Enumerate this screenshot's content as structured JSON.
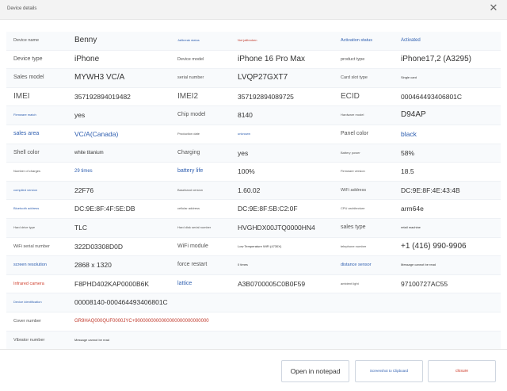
{
  "window": {
    "title": "Device details"
  },
  "rows": [
    {
      "c": [
        {
          "t": "Device name",
          "cls": "lbl small"
        },
        {
          "t": "Benny",
          "cls": "val big"
        },
        {
          "t": "Jailbreak status",
          "cls": "lbl tiny blue"
        },
        {
          "t": "Not jailbroken",
          "cls": "val tiny red"
        },
        {
          "t": "Activation status",
          "cls": "lbl small blue"
        },
        {
          "t": "Activated",
          "cls": "val small blue"
        }
      ]
    },
    {
      "c": [
        {
          "t": "Device type",
          "cls": "lbl"
        },
        {
          "t": "iPhone",
          "cls": "val big"
        },
        {
          "t": "Device model",
          "cls": "lbl small"
        },
        {
          "t": "iPhone 16 Pro Max",
          "cls": "val big"
        },
        {
          "t": "product type",
          "cls": "lbl small"
        },
        {
          "t": "iPhone17,2 (A3295)",
          "cls": "val big"
        }
      ]
    },
    {
      "c": [
        {
          "t": "Sales model",
          "cls": "lbl"
        },
        {
          "t": "MYWH3 VC/A",
          "cls": "val big"
        },
        {
          "t": "serial number",
          "cls": "lbl small"
        },
        {
          "t": "LVQP27GXT7",
          "cls": "val big"
        },
        {
          "t": "Card slot type",
          "cls": "lbl small"
        },
        {
          "t": "Single card",
          "cls": "val tiny"
        }
      ]
    },
    {
      "c": [
        {
          "t": "IMEI",
          "cls": "lbl big"
        },
        {
          "t": "357192894019482",
          "cls": "val"
        },
        {
          "t": "IMEI2",
          "cls": "lbl big"
        },
        {
          "t": "357192894089725",
          "cls": "val"
        },
        {
          "t": "ECID",
          "cls": "lbl big"
        },
        {
          "t": "0004644934068​01C",
          "cls": "val"
        }
      ]
    },
    {
      "c": [
        {
          "t": "Firmware match",
          "cls": "lbl tiny blue"
        },
        {
          "t": "yes",
          "cls": "val"
        },
        {
          "t": "Chip model",
          "cls": "lbl"
        },
        {
          "t": "8140",
          "cls": "val"
        },
        {
          "t": "Hardware model",
          "cls": "lbl tiny"
        },
        {
          "t": "D94AP",
          "cls": "val big"
        }
      ]
    },
    {
      "c": [
        {
          "t": "sales area",
          "cls": "lbl blue"
        },
        {
          "t": "VC/A(Canada)",
          "cls": "val blue"
        },
        {
          "t": "Production date",
          "cls": "lbl tiny"
        },
        {
          "t": "unknown",
          "cls": "val tiny blue"
        },
        {
          "t": "Panel color",
          "cls": "lbl"
        },
        {
          "t": "black",
          "cls": "val blue"
        }
      ]
    },
    {
      "c": [
        {
          "t": "Shell color",
          "cls": "lbl"
        },
        {
          "t": "white titanium",
          "cls": "val small"
        },
        {
          "t": "Charging",
          "cls": "lbl"
        },
        {
          "t": "yes",
          "cls": "val"
        },
        {
          "t": "Battery power",
          "cls": "lbl tiny"
        },
        {
          "t": "58%",
          "cls": "val"
        }
      ]
    },
    {
      "c": [
        {
          "t": "Number of charges",
          "cls": "lbl tiny"
        },
        {
          "t": "29 times",
          "cls": "val small blue"
        },
        {
          "t": "battery life",
          "cls": "lbl blue"
        },
        {
          "t": "100%",
          "cls": "val"
        },
        {
          "t": "Firmware version",
          "cls": "lbl tiny"
        },
        {
          "t": "18.5",
          "cls": "val"
        }
      ]
    },
    {
      "c": [
        {
          "t": "compiled version",
          "cls": "lbl tiny blue"
        },
        {
          "t": "22F76",
          "cls": "val"
        },
        {
          "t": "Baseband version",
          "cls": "lbl tiny"
        },
        {
          "t": "1.60.02",
          "cls": "val"
        },
        {
          "t": "WiFi address",
          "cls": "lbl small"
        },
        {
          "t": "DC:9E:8F:4E:43:4B",
          "cls": "val"
        }
      ]
    },
    {
      "c": [
        {
          "t": "Bluetooth address",
          "cls": "lbl tiny blue"
        },
        {
          "t": "DC:9E:8F:4F:5E:DB",
          "cls": "val"
        },
        {
          "t": "cellular address",
          "cls": "lbl tiny"
        },
        {
          "t": "DC:9E:8F:5B:C2:0F",
          "cls": "val"
        },
        {
          "t": "CPU architecture",
          "cls": "lbl tiny"
        },
        {
          "t": "arm64e",
          "cls": "val"
        }
      ]
    },
    {
      "c": [
        {
          "t": "Hard drive type",
          "cls": "lbl tiny"
        },
        {
          "t": "TLC",
          "cls": "val"
        },
        {
          "t": "Hard disk serial number",
          "cls": "lbl tiny"
        },
        {
          "t": "HVGHDX00JTQ0000HN4",
          "cls": "val"
        },
        {
          "t": "sales type",
          "cls": "lbl"
        },
        {
          "t": "retail machine",
          "cls": "val tiny"
        }
      ]
    },
    {
      "c": [
        {
          "t": "WiFi serial number",
          "cls": "lbl small"
        },
        {
          "t": "322D03308D0D",
          "cls": "val"
        },
        {
          "t": "WiFi module",
          "cls": "lbl"
        },
        {
          "t": "Low Temperature WiFi (4730X)",
          "cls": "val tiny"
        },
        {
          "t": "telephone number",
          "cls": "lbl tiny"
        },
        {
          "t": "+1 (416) 990-9906",
          "cls": "val big"
        }
      ]
    },
    {
      "c": [
        {
          "t": "screen resolution",
          "cls": "lbl small blue"
        },
        {
          "t": "2868 x 1320",
          "cls": "val"
        },
        {
          "t": "force restart",
          "cls": "lbl"
        },
        {
          "t": "0 times",
          "cls": "val tiny"
        },
        {
          "t": "distance sensor",
          "cls": "lbl small blue"
        },
        {
          "t": "Message cannot be read",
          "cls": "val tiny"
        }
      ]
    },
    {
      "c": [
        {
          "t": "Infrared camera",
          "cls": "lbl small red"
        },
        {
          "t": "F8PHD402KAP0000B6K",
          "cls": "val"
        },
        {
          "t": "lattice",
          "cls": "lbl blue"
        },
        {
          "t": "A3B0700005C0B0F59",
          "cls": "val"
        },
        {
          "t": "ambient light",
          "cls": "lbl tiny"
        },
        {
          "t": "97100727AC55",
          "cls": "val"
        }
      ]
    },
    {
      "c": [
        {
          "t": "Device identification",
          "cls": "lbl tiny blue"
        },
        {
          "t": "00008140-000464493406801C",
          "cls": "val"
        }
      ]
    },
    {
      "c": [
        {
          "t": "Cover number",
          "cls": "lbl small"
        },
        {
          "t": "GR9HAQ000QUF0000JYC+9000000000000000000000000000",
          "cls": "val small red"
        }
      ]
    },
    {
      "c": [
        {
          "t": "Vibrator number",
          "cls": "lbl small"
        },
        {
          "t": "Message cannot be read",
          "cls": "val tiny"
        }
      ]
    }
  ],
  "buttons": {
    "open_notepad": "Open in notepad",
    "copy_clipboard": "Screenshot to Clipboard",
    "close": "closure"
  }
}
